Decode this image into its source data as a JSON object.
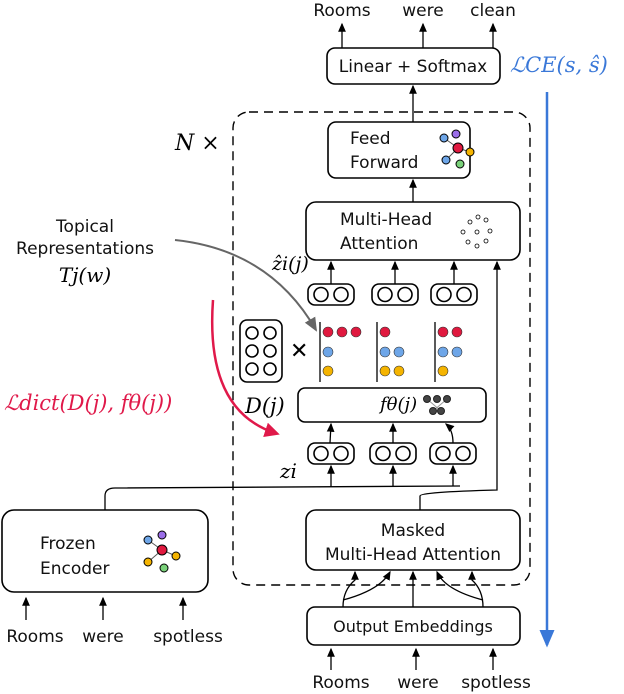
{
  "top_words": [
    "Rooms",
    "were",
    "clean"
  ],
  "linear_softmax": "Linear + Softmax",
  "loss_ce": "ℒCE(s, ŝ)",
  "n_times": "N ×",
  "feed_forward": [
    "Feed",
    "Forward"
  ],
  "multi_head": [
    "Multi-Head",
    "Attention"
  ],
  "z_hat": "ẑi(j)",
  "topical": [
    "Topical",
    "Representations",
    "Tj(w)"
  ],
  "dictionary": "D(j)",
  "f_theta": "fθ(j)",
  "loss_dict": "ℒdict(D(j), fθ(j))",
  "z_i": "zi",
  "frozen_encoder": [
    "Frozen",
    "Encoder"
  ],
  "masked_mha": [
    "Masked",
    "Multi-Head Attention"
  ],
  "output_embeddings": "Output Embeddings",
  "encoder_inputs": [
    "Rooms",
    "were",
    "spotless"
  ],
  "decoder_inputs": [
    "Rooms",
    "were",
    "spotless"
  ],
  "colors": {
    "red": "#e0193f",
    "blue": "#6ea6e8",
    "yellow": "#f5b400",
    "loss_ce": "#3a78d8",
    "loss_dict": "#e0194a"
  }
}
